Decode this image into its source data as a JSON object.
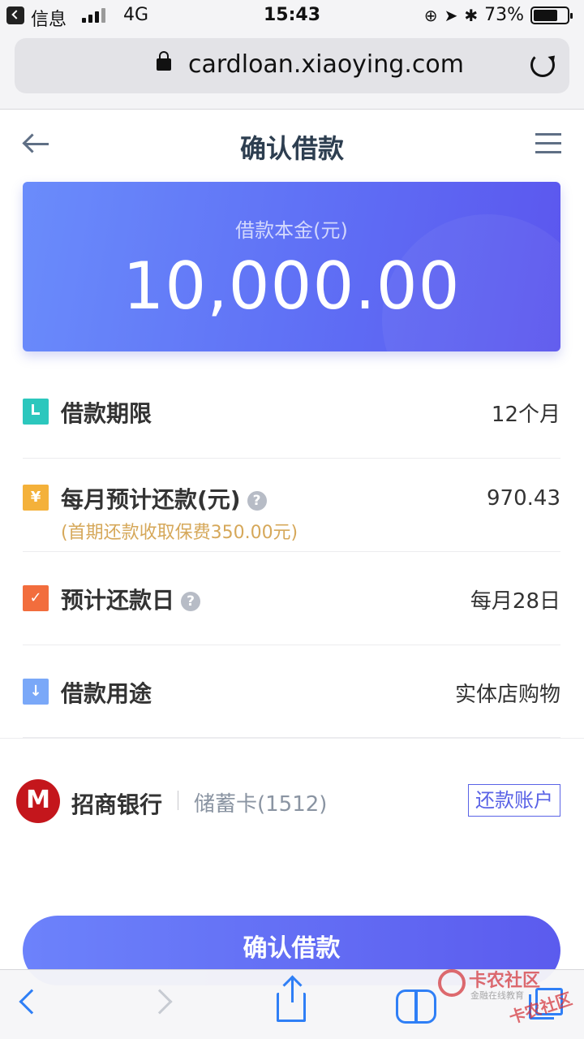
{
  "status_bar": {
    "app": "信息",
    "network": "4G",
    "time": "15:43",
    "battery_text": "73%",
    "battery_level": 0.73
  },
  "browser": {
    "url": "cardloan.xiaoying.com"
  },
  "header": {
    "title": "确认借款"
  },
  "amount_card": {
    "label": "借款本金(元)",
    "value": "10,000.00"
  },
  "rows": [
    {
      "label": "借款期限",
      "value": "12个月",
      "icon": "clock-icon",
      "color": "#2cc7bd"
    },
    {
      "label": "每月预计还款(元)",
      "value": "970.43",
      "sub": "(首期还款收取保费350.00元)",
      "icon": "yen-icon",
      "color": "#f4b13a",
      "icon_glyph": "¥"
    },
    {
      "label": "预计还款日",
      "value": "每月28日",
      "icon": "check-icon",
      "color": "#f26d3d",
      "icon_glyph": "✓"
    },
    {
      "label": "借款用途",
      "value": "实体店购物",
      "icon": "arrow-down-icon",
      "color": "#7aa8f8",
      "icon_glyph": "↓"
    }
  ],
  "bank": {
    "name": "招商银行",
    "card": "储蓄卡(1512)",
    "tag": "还款账户"
  },
  "confirm_button": {
    "label": "确认借款"
  },
  "watermark": {
    "title": "卡农社区",
    "subtitle": "金融在线教育",
    "title2": "卡农社区"
  },
  "colors": {
    "accent": "#5b5bee",
    "title": "#2d3e50",
    "subtext_gold": "#d6a85a",
    "toolbar_blue": "#2f7ff6"
  }
}
